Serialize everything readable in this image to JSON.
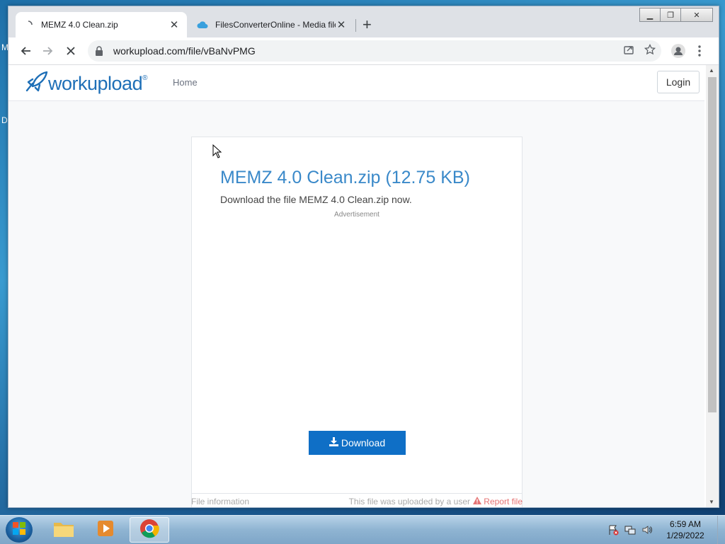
{
  "desktop": {
    "left_chars": [
      "M",
      "D"
    ]
  },
  "browser": {
    "tabs": [
      {
        "title": "MEMZ 4.0 Clean.zip",
        "active": true
      },
      {
        "title": "FilesConverterOnline - Media file",
        "active": false
      }
    ],
    "address": "workupload.com/file/vBaNvPMG"
  },
  "site": {
    "logo": "workupload",
    "logo_mark": "®",
    "nav_home": "Home",
    "login": "Login"
  },
  "file": {
    "title": "MEMZ 4.0 Clean.zip (12.75 KB)",
    "subtitle": "Download the file MEMZ 4.0 Clean.zip now.",
    "ad_label": "Advertisement",
    "download_label": "Download",
    "footer_info": "File information",
    "footer_uploaded": "This file was uploaded by a user",
    "footer_report": "Report file"
  },
  "taskbar": {
    "time": "6:59 AM",
    "date": "1/29/2022"
  },
  "colors": {
    "brand": "#1e6fb7",
    "title_blue": "#3a89c9",
    "download_bg": "#0f6fc6",
    "report_red": "#e57373"
  }
}
